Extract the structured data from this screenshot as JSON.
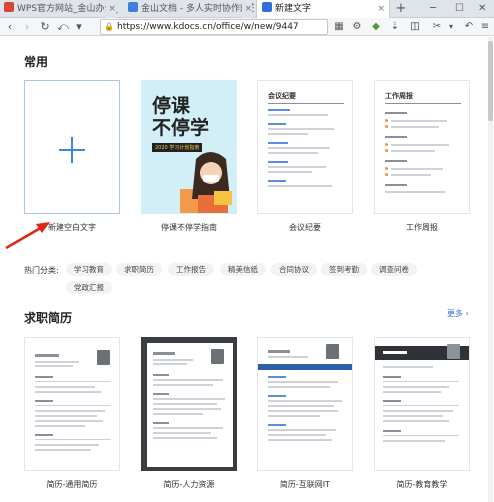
{
  "browser": {
    "tabs": [
      {
        "label": "WPS官方网站_金山办公_办公软件",
        "close": "×"
      },
      {
        "label": "金山文档 - 多人实时协作的在线Off",
        "close": "×"
      },
      {
        "label": "新建文字",
        "close": "×"
      }
    ],
    "new_tab": "+",
    "url": "https://www.kdocs.cn/office/w/new/9447"
  },
  "sections": {
    "common": {
      "title": "常用",
      "cards": [
        {
          "label": "新建空白文字"
        },
        {
          "label": "停课不停学指南",
          "poster_title_line1": "停课",
          "poster_title_line2": "不停学",
          "poster_badge": "2020 学习计划指南"
        },
        {
          "label": "会议纪要",
          "doc_title": "会议纪要"
        },
        {
          "label": "工作周报",
          "doc_title": "工作周报"
        }
      ]
    },
    "hot": {
      "label": "热门分类:",
      "tags": [
        "学习教育",
        "求职简历",
        "工作报告",
        "精美信纸",
        "合同协议",
        "签到考勤",
        "调查问卷",
        "党政汇报"
      ]
    },
    "resume": {
      "title": "求职简历",
      "more": "更多 ›",
      "cards": [
        {
          "label": "简历-通用简历"
        },
        {
          "label": "简历-人力资源"
        },
        {
          "label": "简历-互联网IT"
        },
        {
          "label": "简历-教育教学"
        }
      ]
    }
  }
}
